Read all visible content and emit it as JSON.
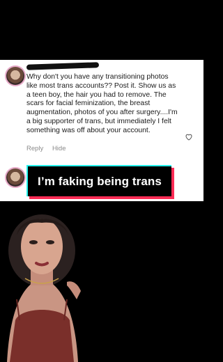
{
  "comment": {
    "text": "Why don't you have any transitioning photos like most trans accounts?? Post it. Show us as a teen boy, the hair you had to remove. The scars for facial feminization, the breast augmentation, photos of you after surgery....I'm a big supporter of trans, but immediately I felt something was off about your account.",
    "actions": {
      "reply": "Reply",
      "hide": "Hide"
    }
  },
  "caption": {
    "text": "I’m faking being trans"
  },
  "colors": {
    "cyan": "#25f4ee",
    "pink": "#fe2c55"
  },
  "icons": [
    "avatar",
    "heart-icon"
  ]
}
